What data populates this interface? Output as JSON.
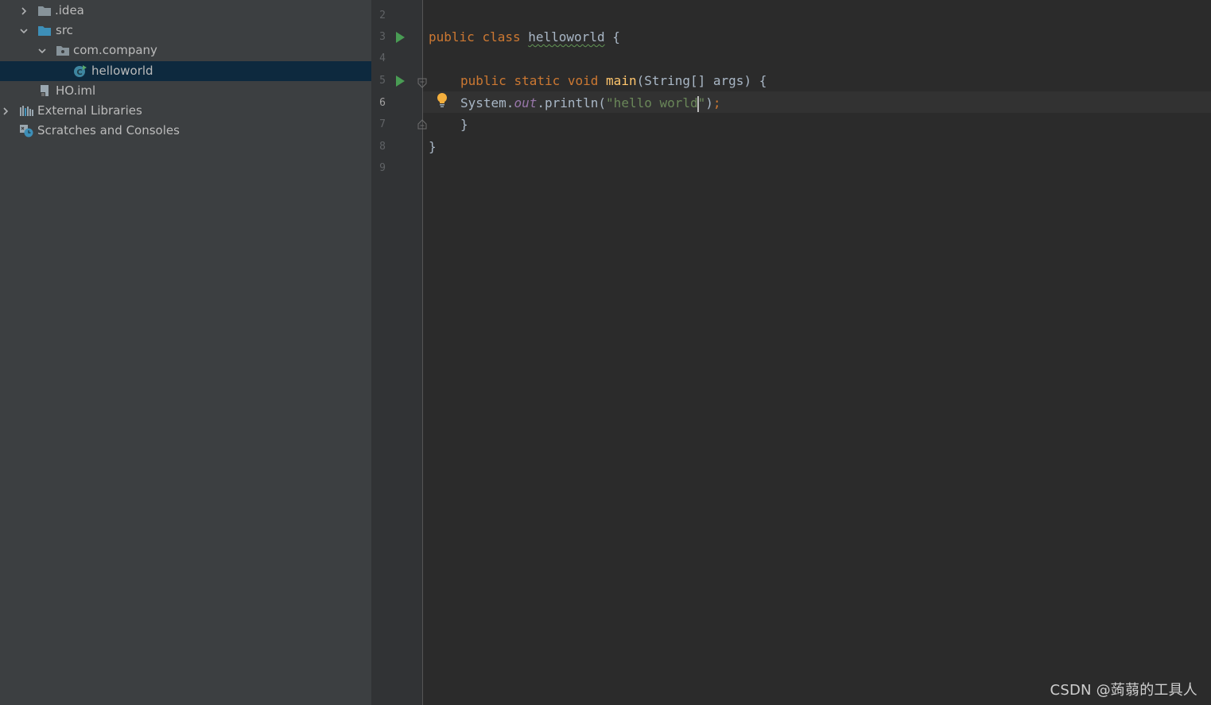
{
  "project_tree": {
    "items": [
      {
        "label": ".idea",
        "expanded": false,
        "icon": "folder-icon"
      },
      {
        "label": "src",
        "expanded": true,
        "icon": "source-folder-icon"
      },
      {
        "label": "com.company",
        "expanded": true,
        "icon": "package-icon"
      },
      {
        "label": "helloworld",
        "selected": true,
        "icon": "java-class-icon"
      },
      {
        "label": "HO.iml",
        "icon": "iml-file-icon"
      },
      {
        "label": "External Libraries",
        "expanded": false,
        "icon": "libraries-icon"
      },
      {
        "label": "Scratches and Consoles",
        "icon": "scratches-icon"
      }
    ]
  },
  "editor": {
    "line_numbers": [
      "2",
      "3",
      "4",
      "5",
      "6",
      "7",
      "8",
      "9"
    ],
    "current_line": "6",
    "code": {
      "line3": {
        "kw1": "public",
        "kw2": "class",
        "class_name": "helloworld",
        "brace": "{"
      },
      "line5": {
        "kw1": "public",
        "kw2": "static",
        "kw3": "void",
        "method": "main",
        "params": "(String[] args) {"
      },
      "line6": {
        "receiver": "System.",
        "field": "out",
        "call": ".println(",
        "string_before_caret": "\"hello world",
        "string_after_caret": "\"",
        "close": ")",
        "semicolon": ";"
      },
      "line7": {
        "brace": "}"
      },
      "line8": {
        "brace": "}"
      }
    }
  },
  "watermark": "CSDN @蒟蒻的工具人",
  "colors": {
    "keyword": "#cc7832",
    "method": "#ffc66d",
    "string": "#6a8759",
    "static_field": "#9876aa",
    "default_text": "#a9b7c6",
    "selection": "#0d293e",
    "sidebar_bg": "#3c3f41",
    "editor_bg": "#2b2b2b",
    "run_icon": "#499c54"
  }
}
